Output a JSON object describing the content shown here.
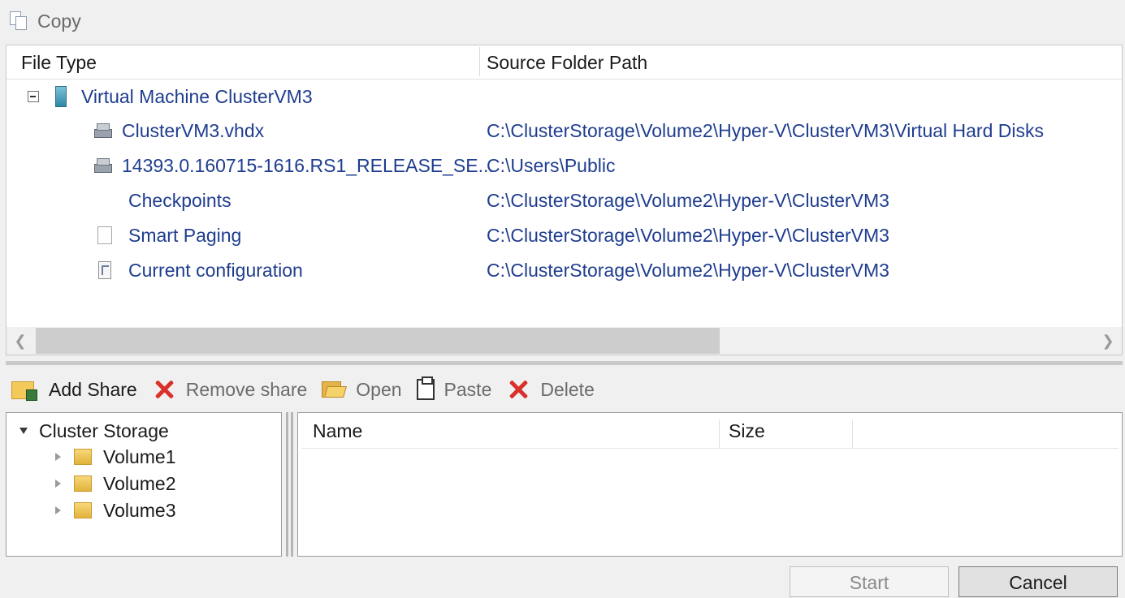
{
  "toolbar_top": {
    "copy_label": "Copy",
    "copy_icon": "copy-icon"
  },
  "filelist": {
    "columns": [
      "File Type",
      "Source Folder Path"
    ],
    "group": {
      "label": "Virtual Machine ClusterVM3",
      "icon": "virtual-machine-icon",
      "expanded": true
    },
    "rows": [
      {
        "name": "ClusterVM3.vhdx",
        "path": "C:\\ClusterStorage\\Volume2\\Hyper-V\\ClusterVM3\\Virtual Hard Disks",
        "icon": "disk-icon"
      },
      {
        "name": "14393.0.160715-1616.RS1_RELEASE_SE...",
        "path": "C:\\Users\\Public",
        "icon": "disk-icon"
      },
      {
        "name": "Checkpoints",
        "path": "C:\\ClusterStorage\\Volume2\\Hyper-V\\ClusterVM3",
        "icon": ""
      },
      {
        "name": "Smart Paging",
        "path": "C:\\ClusterStorage\\Volume2\\Hyper-V\\ClusterVM3",
        "icon": "page-icon"
      },
      {
        "name": "Current configuration",
        "path": "C:\\ClusterStorage\\Volume2\\Hyper-V\\ClusterVM3",
        "icon": "configuration-icon"
      }
    ]
  },
  "toolbar_bottom": {
    "add_share": "Add Share",
    "remove_share": "Remove share",
    "open": "Open",
    "paste": "Paste",
    "delete": "Delete"
  },
  "tree": {
    "root": "Cluster Storage",
    "volumes": [
      "Volume1",
      "Volume2",
      "Volume3"
    ]
  },
  "details": {
    "columns": [
      "Name",
      "Size"
    ]
  },
  "buttons": {
    "start": "Start",
    "cancel": "Cancel"
  },
  "colors": {
    "link_text": "#1f3d8f",
    "disabled_text": "#6b6b6b",
    "delete_red": "#d9302c"
  }
}
